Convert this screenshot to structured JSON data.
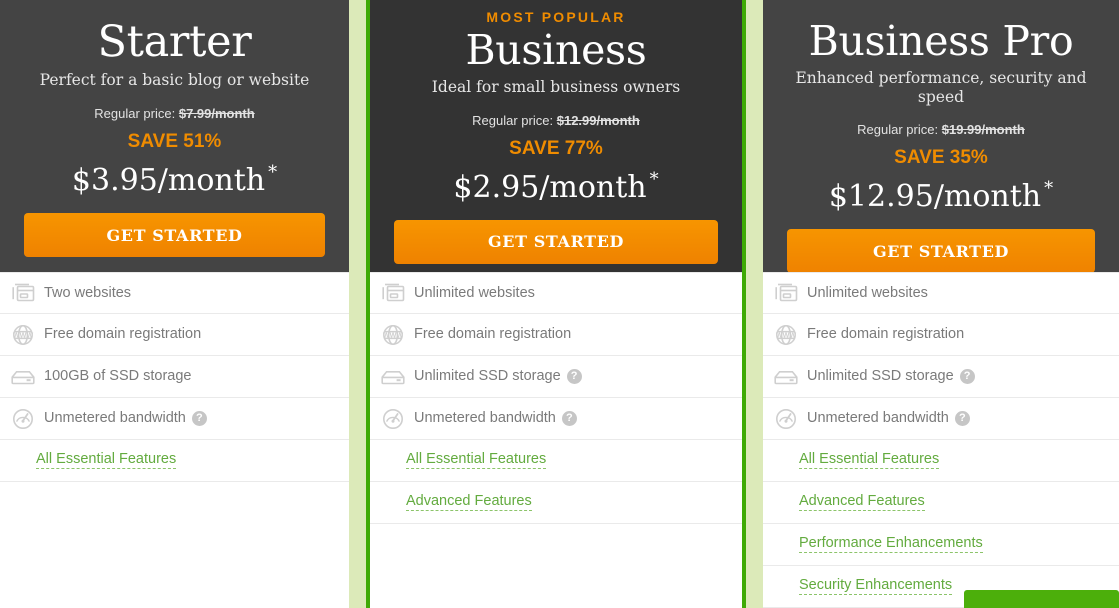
{
  "theme": {
    "accent_orange": "#f08c00",
    "accent_green": "#63ab3f",
    "featured_border_green": "#3faa06",
    "page_background": "#dceab9",
    "header_dark": "#444444",
    "header_dark_featured": "#333333"
  },
  "plans": [
    {
      "id": "starter",
      "badge": null,
      "name": "Starter",
      "tagline": "Perfect for a basic blog or website",
      "regular_price_label": "Regular price:",
      "regular_price_amount": "$7.99/month",
      "save_text": "SAVE 51%",
      "current_price": "$3.95/month",
      "price_asterisk": "*",
      "cta_label": "GET STARTED",
      "features": [
        {
          "icon": "websites-icon",
          "label": "Two websites",
          "help": false
        },
        {
          "icon": "www-globe-icon",
          "label": "Free domain registration",
          "help": false
        },
        {
          "icon": "ssd-storage-icon",
          "label": "100GB of SSD storage",
          "help": false
        },
        {
          "icon": "bandwidth-gauge-icon",
          "label": "Unmetered bandwidth",
          "help": true
        }
      ],
      "links": [
        "All Essential Features"
      ]
    },
    {
      "id": "business",
      "badge": "MOST POPULAR",
      "name": "Business",
      "tagline": "Ideal for small business owners",
      "regular_price_label": "Regular price:",
      "regular_price_amount": "$12.99/month",
      "save_text": "SAVE 77%",
      "current_price": "$2.95/month",
      "price_asterisk": "*",
      "cta_label": "GET STARTED",
      "features": [
        {
          "icon": "websites-icon",
          "label": "Unlimited websites",
          "help": false
        },
        {
          "icon": "www-globe-icon",
          "label": "Free domain registration",
          "help": false
        },
        {
          "icon": "ssd-storage-icon",
          "label": "Unlimited SSD storage",
          "help": true
        },
        {
          "icon": "bandwidth-gauge-icon",
          "label": "Unmetered bandwidth",
          "help": true
        }
      ],
      "links": [
        "All Essential Features",
        "Advanced Features"
      ]
    },
    {
      "id": "pro",
      "badge": null,
      "name": "Business Pro",
      "tagline": "Enhanced performance, security and speed",
      "regular_price_label": "Regular price:",
      "regular_price_amount": "$19.99/month",
      "save_text": "SAVE 35%",
      "current_price": "$12.95/month",
      "price_asterisk": "*",
      "cta_label": "GET STARTED",
      "features": [
        {
          "icon": "websites-icon",
          "label": "Unlimited websites",
          "help": false
        },
        {
          "icon": "www-globe-icon",
          "label": "Free domain registration",
          "help": false
        },
        {
          "icon": "ssd-storage-icon",
          "label": "Unlimited SSD storage",
          "help": true
        },
        {
          "icon": "bandwidth-gauge-icon",
          "label": "Unmetered bandwidth",
          "help": true
        }
      ],
      "links": [
        "All Essential Features",
        "Advanced Features",
        "Performance Enhancements",
        "Security Enhancements"
      ]
    }
  ],
  "help_icon_glyph": "?"
}
